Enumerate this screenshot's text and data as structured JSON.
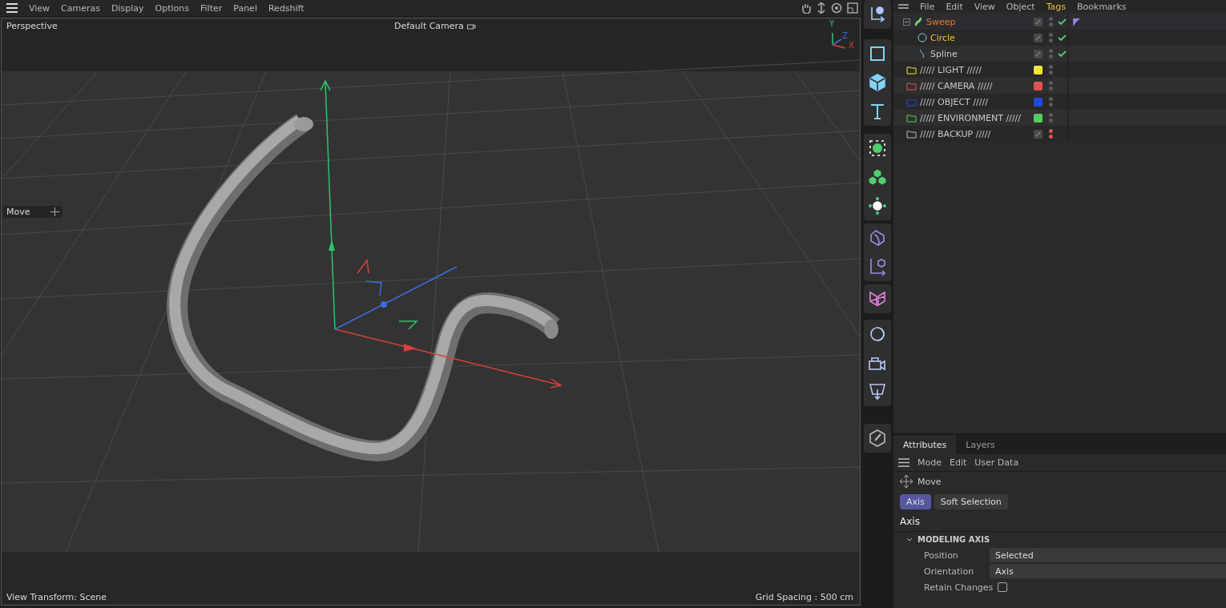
{
  "viewport_menu": [
    "View",
    "Cameras",
    "Display",
    "Options",
    "Filter",
    "Panel",
    "Redshift"
  ],
  "viewport": {
    "view_name": "Perspective",
    "camera": "Default Camera",
    "tool_label": "Move",
    "footer_left": "View Transform: Scene",
    "footer_right": "Grid Spacing : 500 cm",
    "gizmo_labels": [
      "Y",
      "Z",
      "X"
    ]
  },
  "object_manager": {
    "menu": [
      {
        "label": "File",
        "selected": false
      },
      {
        "label": "Edit",
        "selected": false
      },
      {
        "label": "View",
        "selected": false
      },
      {
        "label": "Object",
        "selected": false
      },
      {
        "label": "Tags",
        "selected": true
      },
      {
        "label": "Bookmarks",
        "selected": false
      }
    ],
    "objects": [
      {
        "kind": "sweep",
        "name": "Sweep",
        "selected": true,
        "active": false,
        "expanded": true,
        "enabled": true,
        "hidden": false,
        "has_tag": true,
        "children": [
          {
            "kind": "circle",
            "name": "Circle",
            "selected": false,
            "active": true,
            "enabled": true,
            "hidden": false,
            "has_tag": false
          },
          {
            "kind": "spline",
            "name": "Spline",
            "selected": false,
            "active": false,
            "enabled": true,
            "hidden": false,
            "has_tag": false
          }
        ]
      },
      {
        "kind": "folder",
        "name": "///// LIGHT /////",
        "selected": false,
        "active": false,
        "color": "#f0e63c",
        "hidden": false,
        "has_tag": false
      },
      {
        "kind": "folder",
        "name": "///// CAMERA /////",
        "selected": false,
        "active": false,
        "color": "#e05252",
        "hidden": false,
        "has_tag": false
      },
      {
        "kind": "folder",
        "name": "///// OBJECT /////",
        "selected": false,
        "active": false,
        "color": "#2347d6",
        "hidden": false,
        "has_tag": false
      },
      {
        "kind": "folder",
        "name": "///// ENVIRONMENT /////",
        "selected": false,
        "active": false,
        "color": "#56cc5e",
        "hidden": false,
        "has_tag": false
      },
      {
        "kind": "folder",
        "name": "///// BACKUP /////",
        "selected": false,
        "active": false,
        "hidden": true,
        "has_tag": false
      }
    ]
  },
  "attributes": {
    "tabs": [
      {
        "label": "Attributes",
        "selected": true
      },
      {
        "label": "Layers",
        "selected": false
      }
    ],
    "menu": [
      "Mode",
      "Edit",
      "User Data"
    ],
    "tool": "Move",
    "subtabs": [
      {
        "label": "Axis",
        "selected": true
      },
      {
        "label": "Soft Selection",
        "selected": false
      }
    ],
    "heading": "Axis",
    "group": {
      "title": "MODELING AXIS",
      "expanded": true,
      "fields": [
        {
          "kind": "dropdown",
          "label": "Position",
          "value": "Selected"
        },
        {
          "kind": "dropdown",
          "label": "Orientation",
          "value": "Axis"
        },
        {
          "kind": "checkbox",
          "label": "Retain Changes",
          "checked": false
        }
      ]
    }
  }
}
